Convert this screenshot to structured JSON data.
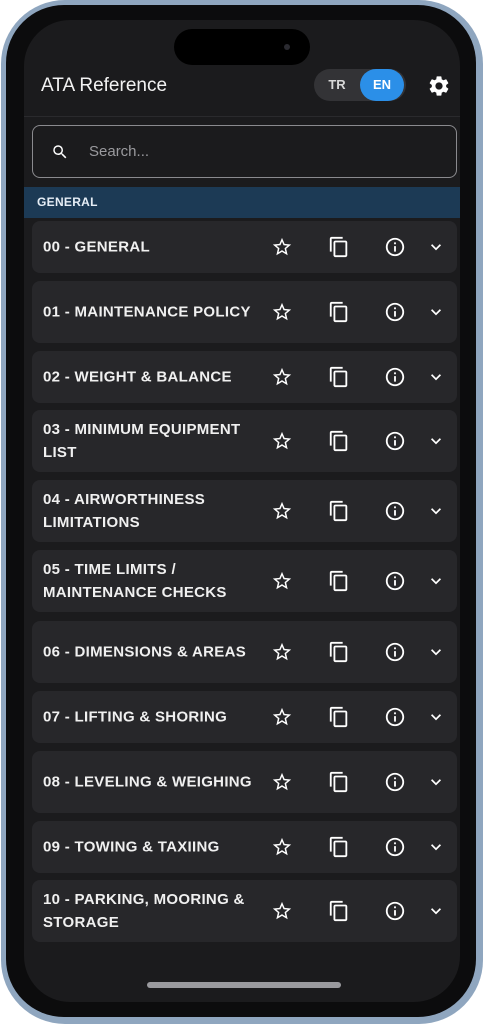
{
  "app": {
    "title": "ATA Reference",
    "language_options": [
      "TR",
      "EN"
    ],
    "selected_language": "EN",
    "accent_color": "#2b8fe8"
  },
  "search": {
    "placeholder": "Search...",
    "value": ""
  },
  "section": {
    "title": "GENERAL",
    "color": "#1c3a55"
  },
  "chapters": [
    {
      "label": "00 - GENERAL"
    },
    {
      "label": "01 - MAINTENANCE POLICY"
    },
    {
      "label": "02 - WEIGHT & BALANCE"
    },
    {
      "label": "03 - MINIMUM EQUIPMENT LIST"
    },
    {
      "label": "04 - AIRWORTHINESS LIMITATIONS"
    },
    {
      "label": "05 - TIME LIMITS / MAINTENANCE CHECKS"
    },
    {
      "label": "06 - DIMENSIONS & AREAS"
    },
    {
      "label": "07 - LIFTING & SHORING"
    },
    {
      "label": "08 - LEVELING & WEIGHING"
    },
    {
      "label": "09 - TOWING & TAXIING"
    },
    {
      "label": "10 - PARKING, MOORING & STORAGE"
    }
  ],
  "icons": {
    "row_actions": [
      "star-icon",
      "copy-icon",
      "info-icon",
      "chevron-down-icon"
    ],
    "search": "search-icon",
    "settings": "gear-icon"
  }
}
